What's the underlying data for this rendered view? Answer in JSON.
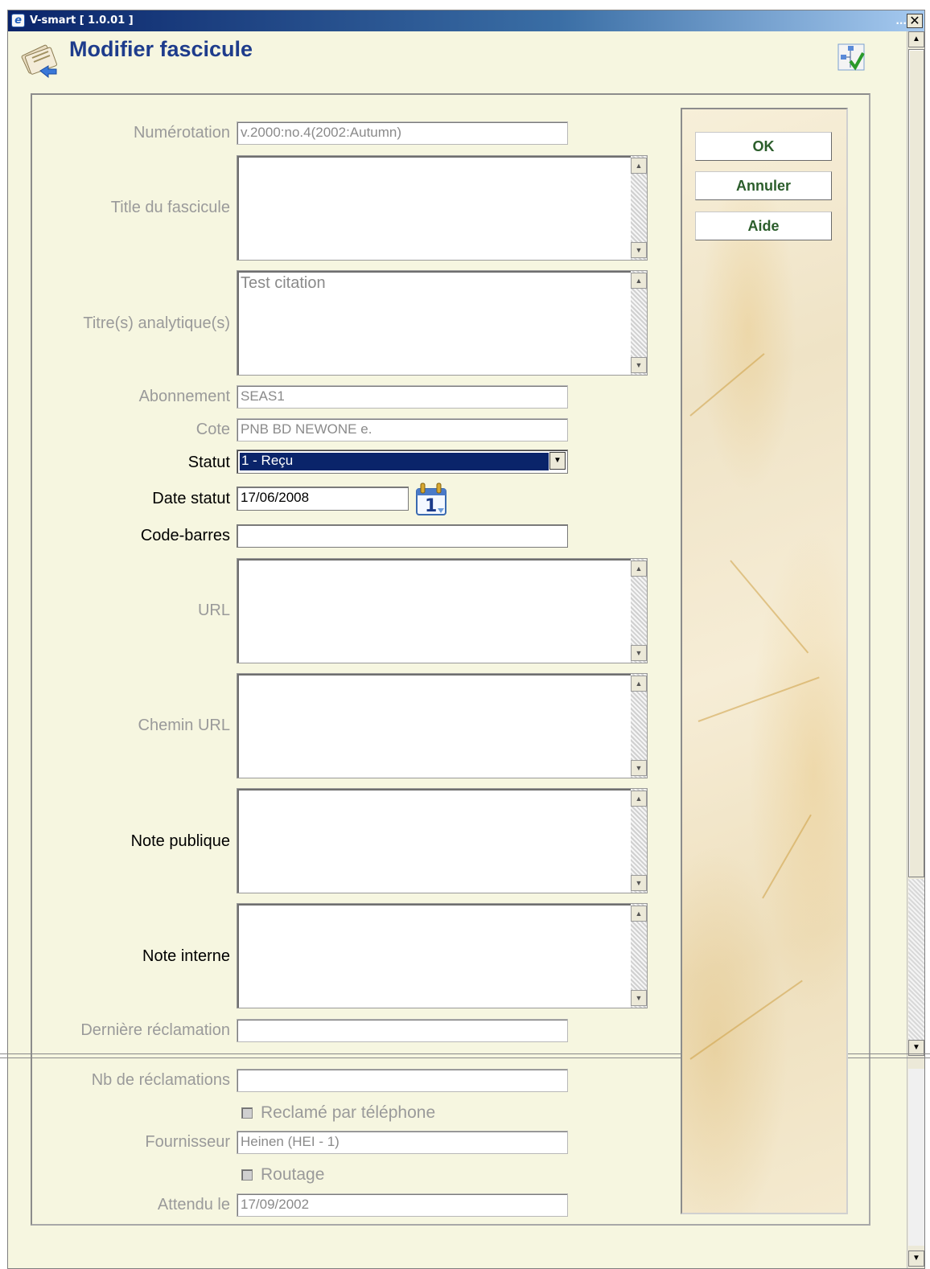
{
  "window": {
    "title": "V-smart [ 1.0.01 ]",
    "dots": "...",
    "close": "✕"
  },
  "page": {
    "title": "Modifier fascicule"
  },
  "form": {
    "numerotation": {
      "label": "Numérotation",
      "value": "v.2000:no.4(2002:Autumn)"
    },
    "title_fascicule": {
      "label": "Title du fascicule",
      "value": ""
    },
    "titres_analytiques": {
      "label": "Titre(s) analytique(s)",
      "value": "Test citation"
    },
    "abonnement": {
      "label": "Abonnement",
      "value": "SEAS1"
    },
    "cote": {
      "label": "Cote",
      "value": "PNB BD NEWONE e."
    },
    "statut": {
      "label": "Statut",
      "value": "1 - Reçu"
    },
    "date_statut": {
      "label": "Date statut",
      "value": "17/06/2008"
    },
    "code_barres": {
      "label": "Code-barres",
      "value": ""
    },
    "url": {
      "label": "URL",
      "value": ""
    },
    "chemin_url": {
      "label": "Chemin URL",
      "value": ""
    },
    "note_publique": {
      "label": "Note publique",
      "value": ""
    },
    "note_interne": {
      "label": "Note interne",
      "value": ""
    },
    "derniere_reclamation": {
      "label": "Dernière réclamation",
      "value": ""
    },
    "nb_reclamations": {
      "label": "Nb de réclamations",
      "value": ""
    },
    "reclame_telephone": {
      "label": "Reclamé par téléphone",
      "checked": false
    },
    "fournisseur": {
      "label": "Fournisseur",
      "value": "Heinen (HEI - 1)"
    },
    "routage": {
      "label": "Routage",
      "checked": false
    },
    "attendu_le": {
      "label": "Attendu le",
      "value": "17/09/2002"
    }
  },
  "buttons": {
    "ok": "OK",
    "annuler": "Annuler",
    "aide": "Aide"
  },
  "icons": {
    "app": "ie-icon",
    "page": "newspaper-icon",
    "tree": "tree-check-icon",
    "calendar": "calendar-icon"
  },
  "colors": {
    "title": "#1e3c8c",
    "selected": "#0a246a",
    "button_text": "#2b5d2b",
    "background": "#f6f6e0"
  }
}
